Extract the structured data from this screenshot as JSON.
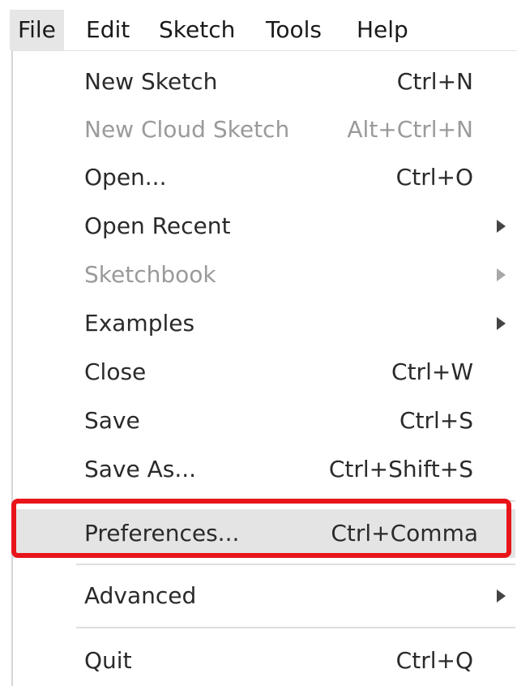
{
  "menubar": {
    "items": [
      {
        "label": "File"
      },
      {
        "label": "Edit"
      },
      {
        "label": "Sketch"
      },
      {
        "label": "Tools"
      },
      {
        "label": "Help"
      }
    ]
  },
  "file_menu": {
    "items": [
      {
        "label": "New Sketch",
        "shortcut": "Ctrl+N",
        "enabled": true
      },
      {
        "label": "New Cloud Sketch",
        "shortcut": "Alt+Ctrl+N",
        "enabled": false
      },
      {
        "label": "Open...",
        "shortcut": "Ctrl+O",
        "enabled": true
      },
      {
        "label": "Open Recent",
        "shortcut": "",
        "enabled": true,
        "submenu": true
      },
      {
        "label": "Sketchbook",
        "shortcut": "",
        "enabled": false,
        "submenu": true
      },
      {
        "label": "Examples",
        "shortcut": "",
        "enabled": true,
        "submenu": true
      },
      {
        "label": "Close",
        "shortcut": "Ctrl+W",
        "enabled": true
      },
      {
        "label": "Save",
        "shortcut": "Ctrl+S",
        "enabled": true
      },
      {
        "label": "Save As...",
        "shortcut": "Ctrl+Shift+S",
        "enabled": true
      },
      {
        "label": "Preferences...",
        "shortcut": "Ctrl+Comma",
        "enabled": true,
        "highlighted": true
      },
      {
        "label": "Advanced",
        "shortcut": "",
        "enabled": true,
        "submenu": true
      },
      {
        "label": "Quit",
        "shortcut": "Ctrl+Q",
        "enabled": true
      }
    ]
  },
  "annotation": {
    "highlight_color": "#e8141a",
    "target": "Preferences..."
  },
  "colors": {
    "text": "#2a2a2a",
    "disabled_text": "#9a9a9a",
    "hover_bg": "#e4e4e4",
    "active_menubar_bg": "#e6e6e6"
  }
}
